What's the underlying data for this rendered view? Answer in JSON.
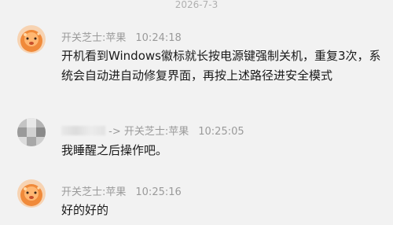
{
  "date_separator": "2026-7-3",
  "messages": [
    {
      "sender": "开关芝士:苹果",
      "time": "10:24:18",
      "text": "开机看到Windows徽标就长按电源键强制关机，重复3次，系统会自动进自动修复界面，再按上述路径进安全模式"
    },
    {
      "sender_suffix": "-> 开关芝士:苹果",
      "time": "10:25:05",
      "text": "我睡醒之后操作吧。"
    },
    {
      "sender": "开关芝士:苹果",
      "time": "10:25:16",
      "text": "好的好的"
    }
  ],
  "colors": {
    "background": "#f2f2f2",
    "meta_text": "#9a9a9a",
    "message_text": "#1a1a1a",
    "avatar_orange": "#f08a3a"
  },
  "icons": {
    "cheese-avatar": "cartoon orange cheese mascot",
    "blurred-avatar": "pixelated avatar"
  }
}
